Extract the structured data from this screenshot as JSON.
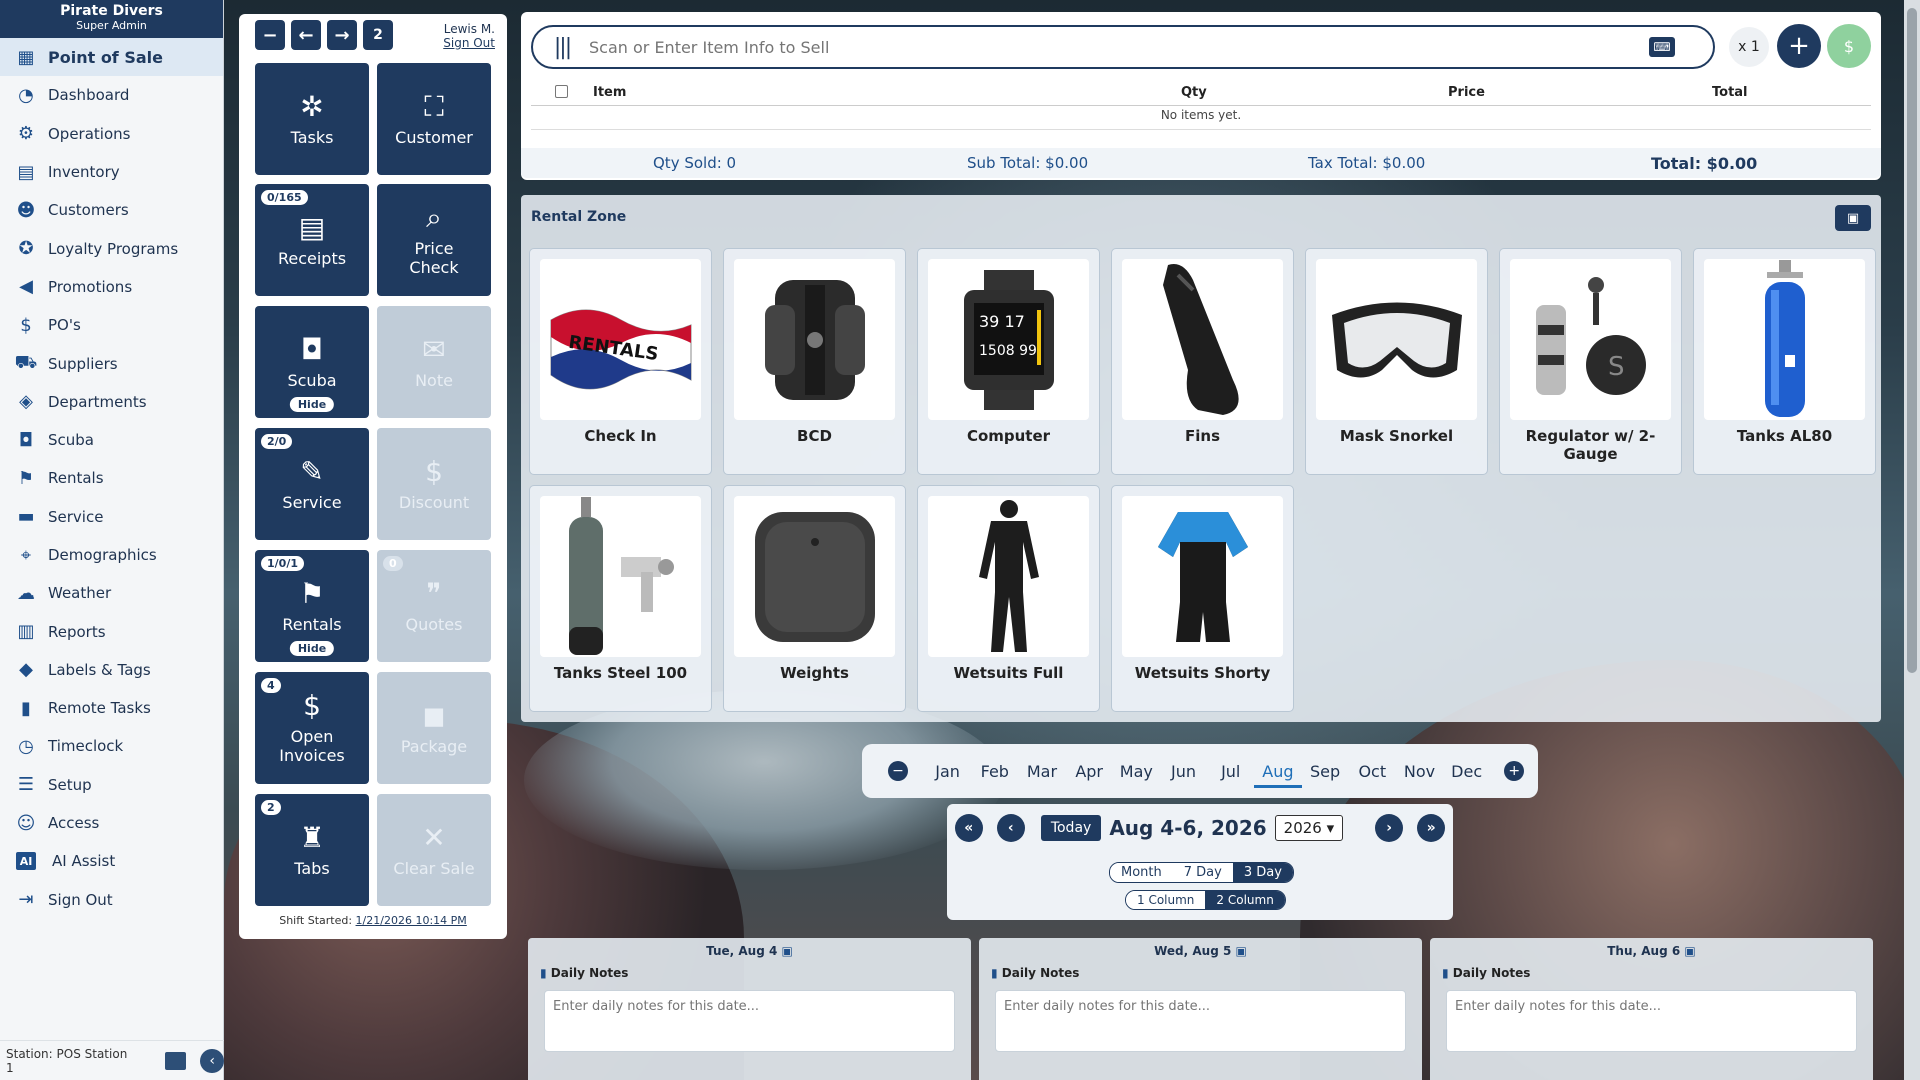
{
  "brand": {
    "name": "Pirate Divers",
    "role": "Super Admin"
  },
  "nav": [
    {
      "label": "Point of Sale",
      "icon": "register-icon"
    },
    {
      "label": "Dashboard",
      "icon": "dashboard-icon"
    },
    {
      "label": "Operations",
      "icon": "operations-icon"
    },
    {
      "label": "Inventory",
      "icon": "inventory-icon"
    },
    {
      "label": "Customers",
      "icon": "customers-icon"
    },
    {
      "label": "Loyalty Programs",
      "icon": "loyalty-icon"
    },
    {
      "label": "Promotions",
      "icon": "megaphone-icon"
    },
    {
      "label": "PO's",
      "icon": "purchase-order-icon"
    },
    {
      "label": "Suppliers",
      "icon": "truck-icon"
    },
    {
      "label": "Departments",
      "icon": "layers-icon"
    },
    {
      "label": "Scuba",
      "icon": "scuba-icon"
    },
    {
      "label": "Rentals",
      "icon": "flag-icon"
    },
    {
      "label": "Service",
      "icon": "toolbox-icon"
    },
    {
      "label": "Demographics",
      "icon": "map-pin-icon"
    },
    {
      "label": "Weather",
      "icon": "weather-icon"
    },
    {
      "label": "Reports",
      "icon": "bar-chart-icon"
    },
    {
      "label": "Labels & Tags",
      "icon": "tag-icon"
    },
    {
      "label": "Remote Tasks",
      "icon": "tablet-icon"
    },
    {
      "label": "Timeclock",
      "icon": "clock-icon"
    },
    {
      "label": "Setup",
      "icon": "sliders-icon"
    },
    {
      "label": "Access",
      "icon": "user-lock-icon"
    },
    {
      "label": "AI Assist",
      "icon": "ai-icon"
    },
    {
      "label": "Sign Out",
      "icon": "sign-out-icon"
    }
  ],
  "station": "Station: POS Station 1",
  "user": {
    "name": "Lewis M.",
    "signout": "Sign Out"
  },
  "topbar": {
    "count": "2"
  },
  "tiles": {
    "tasks": "Tasks",
    "customer": "Customer",
    "receipts": {
      "label": "Receipts",
      "badge": "0/165"
    },
    "price_check": "Price Check",
    "scuba": {
      "label": "Scuba",
      "hide": "Hide"
    },
    "note": "Note",
    "service": {
      "label": "Service",
      "badge": "2/0"
    },
    "discount": "Discount",
    "rentals": {
      "label": "Rentals",
      "badge": "1/0/1",
      "hide": "Hide"
    },
    "quotes": {
      "label": "Quotes",
      "badge": "0"
    },
    "open_invoices": {
      "label": "Open Invoices",
      "badge": "4"
    },
    "package": "Package",
    "tabs": {
      "label": "Tabs",
      "badge": "2"
    },
    "clear_sale": "Clear Sale"
  },
  "shift": {
    "label": "Shift Started:",
    "time": "1/21/2026 10:14 PM"
  },
  "sale": {
    "placeholder": "Scan or Enter Item Info to Sell",
    "qty_multiplier": "x 1",
    "columns": {
      "item": "Item",
      "qty": "Qty",
      "price": "Price",
      "total": "Total"
    },
    "empty": "No items yet.",
    "totals": {
      "qty_sold": "Qty Sold:  0",
      "sub_total": "Sub Total:  $0.00",
      "tax_total": "Tax Total:  $0.00",
      "total": "Total:  $0.00"
    }
  },
  "rental_zone": {
    "title": "Rental Zone",
    "items": [
      "Check In",
      "BCD",
      "Computer",
      "Fins",
      "Mask Snorkel",
      "Regulator w/ 2-Gauge",
      "Tanks AL80",
      "Tanks Steel 100",
      "Weights",
      "Wetsuits Full",
      "Wetsuits Shorty"
    ]
  },
  "months": [
    "Jan",
    "Feb",
    "Mar",
    "Apr",
    "May",
    "Jun",
    "Jul",
    "Aug",
    "Sep",
    "Oct",
    "Nov",
    "Dec"
  ],
  "selected_month": "Aug",
  "calendar": {
    "today": "Today",
    "range": "Aug 4-6, 2026",
    "year": "2026",
    "views": [
      "Month",
      "7 Day",
      "3 Day"
    ],
    "active_view": "3 Day",
    "columns": [
      "1 Column",
      "2 Column"
    ],
    "active_columns": "2 Column"
  },
  "days": [
    {
      "date": "Tue, Aug 4",
      "notes_label": "Daily Notes",
      "placeholder": "Enter daily notes for this date..."
    },
    {
      "date": "Wed, Aug 5",
      "notes_label": "Daily Notes",
      "placeholder": "Enter daily notes for this date..."
    },
    {
      "date": "Thu, Aug 6",
      "notes_label": "Daily Notes",
      "placeholder": "Enter daily notes for this date..."
    }
  ]
}
